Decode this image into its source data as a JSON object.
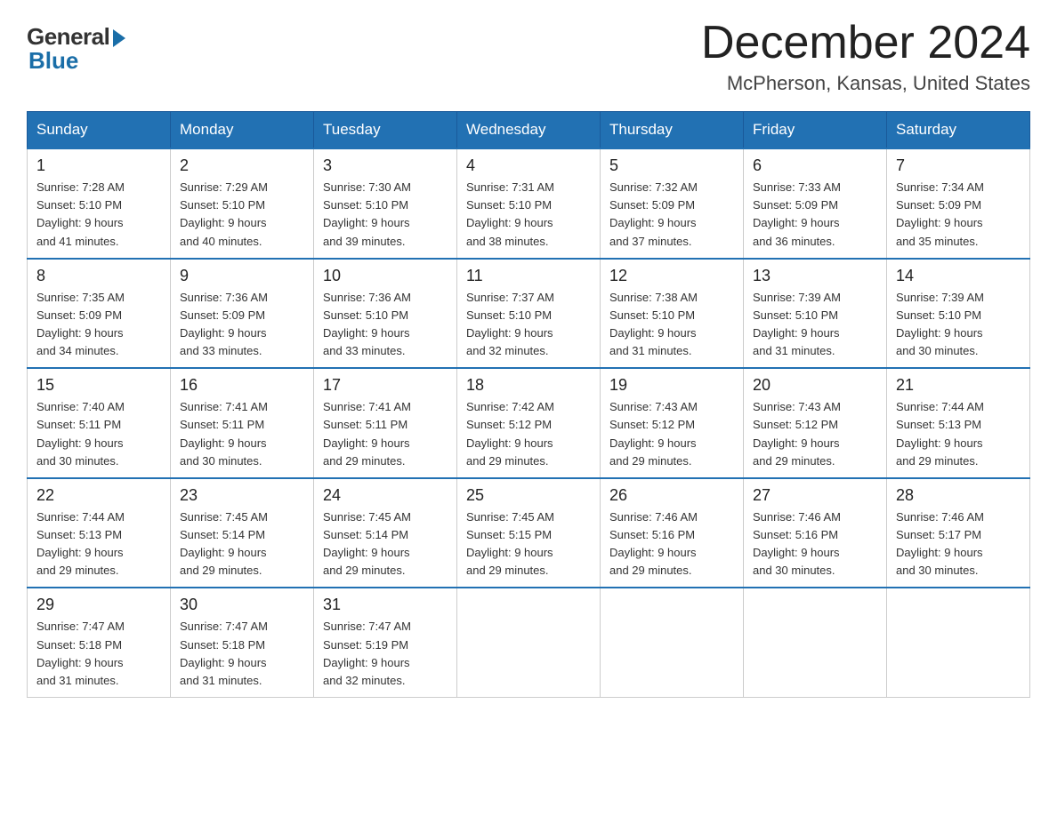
{
  "logo": {
    "general": "General",
    "blue": "Blue"
  },
  "title": {
    "month_year": "December 2024",
    "location": "McPherson, Kansas, United States"
  },
  "days_of_week": [
    "Sunday",
    "Monday",
    "Tuesday",
    "Wednesday",
    "Thursday",
    "Friday",
    "Saturday"
  ],
  "weeks": [
    [
      {
        "day": "1",
        "sunrise": "7:28 AM",
        "sunset": "5:10 PM",
        "daylight": "9 hours and 41 minutes."
      },
      {
        "day": "2",
        "sunrise": "7:29 AM",
        "sunset": "5:10 PM",
        "daylight": "9 hours and 40 minutes."
      },
      {
        "day": "3",
        "sunrise": "7:30 AM",
        "sunset": "5:10 PM",
        "daylight": "9 hours and 39 minutes."
      },
      {
        "day": "4",
        "sunrise": "7:31 AM",
        "sunset": "5:10 PM",
        "daylight": "9 hours and 38 minutes."
      },
      {
        "day": "5",
        "sunrise": "7:32 AM",
        "sunset": "5:09 PM",
        "daylight": "9 hours and 37 minutes."
      },
      {
        "day": "6",
        "sunrise": "7:33 AM",
        "sunset": "5:09 PM",
        "daylight": "9 hours and 36 minutes."
      },
      {
        "day": "7",
        "sunrise": "7:34 AM",
        "sunset": "5:09 PM",
        "daylight": "9 hours and 35 minutes."
      }
    ],
    [
      {
        "day": "8",
        "sunrise": "7:35 AM",
        "sunset": "5:09 PM",
        "daylight": "9 hours and 34 minutes."
      },
      {
        "day": "9",
        "sunrise": "7:36 AM",
        "sunset": "5:09 PM",
        "daylight": "9 hours and 33 minutes."
      },
      {
        "day": "10",
        "sunrise": "7:36 AM",
        "sunset": "5:10 PM",
        "daylight": "9 hours and 33 minutes."
      },
      {
        "day": "11",
        "sunrise": "7:37 AM",
        "sunset": "5:10 PM",
        "daylight": "9 hours and 32 minutes."
      },
      {
        "day": "12",
        "sunrise": "7:38 AM",
        "sunset": "5:10 PM",
        "daylight": "9 hours and 31 minutes."
      },
      {
        "day": "13",
        "sunrise": "7:39 AM",
        "sunset": "5:10 PM",
        "daylight": "9 hours and 31 minutes."
      },
      {
        "day": "14",
        "sunrise": "7:39 AM",
        "sunset": "5:10 PM",
        "daylight": "9 hours and 30 minutes."
      }
    ],
    [
      {
        "day": "15",
        "sunrise": "7:40 AM",
        "sunset": "5:11 PM",
        "daylight": "9 hours and 30 minutes."
      },
      {
        "day": "16",
        "sunrise": "7:41 AM",
        "sunset": "5:11 PM",
        "daylight": "9 hours and 30 minutes."
      },
      {
        "day": "17",
        "sunrise": "7:41 AM",
        "sunset": "5:11 PM",
        "daylight": "9 hours and 29 minutes."
      },
      {
        "day": "18",
        "sunrise": "7:42 AM",
        "sunset": "5:12 PM",
        "daylight": "9 hours and 29 minutes."
      },
      {
        "day": "19",
        "sunrise": "7:43 AM",
        "sunset": "5:12 PM",
        "daylight": "9 hours and 29 minutes."
      },
      {
        "day": "20",
        "sunrise": "7:43 AM",
        "sunset": "5:12 PM",
        "daylight": "9 hours and 29 minutes."
      },
      {
        "day": "21",
        "sunrise": "7:44 AM",
        "sunset": "5:13 PM",
        "daylight": "9 hours and 29 minutes."
      }
    ],
    [
      {
        "day": "22",
        "sunrise": "7:44 AM",
        "sunset": "5:13 PM",
        "daylight": "9 hours and 29 minutes."
      },
      {
        "day": "23",
        "sunrise": "7:45 AM",
        "sunset": "5:14 PM",
        "daylight": "9 hours and 29 minutes."
      },
      {
        "day": "24",
        "sunrise": "7:45 AM",
        "sunset": "5:14 PM",
        "daylight": "9 hours and 29 minutes."
      },
      {
        "day": "25",
        "sunrise": "7:45 AM",
        "sunset": "5:15 PM",
        "daylight": "9 hours and 29 minutes."
      },
      {
        "day": "26",
        "sunrise": "7:46 AM",
        "sunset": "5:16 PM",
        "daylight": "9 hours and 29 minutes."
      },
      {
        "day": "27",
        "sunrise": "7:46 AM",
        "sunset": "5:16 PM",
        "daylight": "9 hours and 30 minutes."
      },
      {
        "day": "28",
        "sunrise": "7:46 AM",
        "sunset": "5:17 PM",
        "daylight": "9 hours and 30 minutes."
      }
    ],
    [
      {
        "day": "29",
        "sunrise": "7:47 AM",
        "sunset": "5:18 PM",
        "daylight": "9 hours and 31 minutes."
      },
      {
        "day": "30",
        "sunrise": "7:47 AM",
        "sunset": "5:18 PM",
        "daylight": "9 hours and 31 minutes."
      },
      {
        "day": "31",
        "sunrise": "7:47 AM",
        "sunset": "5:19 PM",
        "daylight": "9 hours and 32 minutes."
      },
      null,
      null,
      null,
      null
    ]
  ]
}
